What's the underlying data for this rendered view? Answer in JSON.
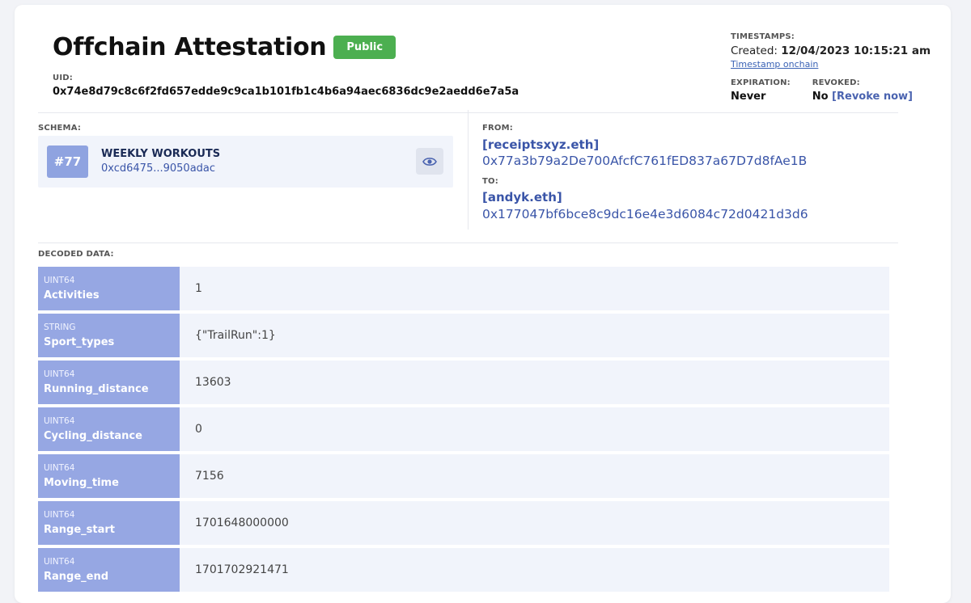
{
  "header": {
    "title": "Offchain Attestation",
    "badge": "Public",
    "uid_label": "UID:",
    "uid": "0x74e8d79c8c6f2fd657edde9c9ca1b101fb1c4b6a94aec6836dc9e2aedd6e7a5a"
  },
  "timestamps": {
    "label": "TIMESTAMPS:",
    "created_prefix": "Created:",
    "created_value": "12/04/2023 10:15:21 am",
    "onchain_link": "Timestamp onchain",
    "expiration_label": "EXPIRATION:",
    "expiration_value": "Never",
    "revoked_label": "REVOKED:",
    "revoked_value": "No",
    "revoke_link": "[Revoke now]"
  },
  "schema": {
    "label": "SCHEMA:",
    "number": "#77",
    "name": "WEEKLY WORKOUTS",
    "address": "0xcd6475...9050adac",
    "view_icon": "eye-icon"
  },
  "from": {
    "label": "FROM:",
    "ens": "[receiptsxyz.eth]",
    "address": "0x77a3b79a2De700AfcfC761fED837a67D7d8fAe1B"
  },
  "to": {
    "label": "TO:",
    "ens": "[andyk.eth]",
    "address": "0x177047bf6bce8c9dc16e4e3d6084c72d0421d3d6"
  },
  "decoded": {
    "label": "DECODED DATA:",
    "rows": [
      {
        "type": "UINT64",
        "name": "Activities",
        "value": "1"
      },
      {
        "type": "STRING",
        "name": "Sport_types",
        "value": "{\"TrailRun\":1}"
      },
      {
        "type": "UINT64",
        "name": "Running_distance",
        "value": "13603"
      },
      {
        "type": "UINT64",
        "name": "Cycling_distance",
        "value": "0"
      },
      {
        "type": "UINT64",
        "name": "Moving_time",
        "value": "7156"
      },
      {
        "type": "UINT64",
        "name": "Range_start",
        "value": "1701648000000"
      },
      {
        "type": "UINT64",
        "name": "Range_end",
        "value": "1701702921471"
      }
    ]
  },
  "colors": {
    "badge_green": "#4caf50",
    "schema_chip": "#8fa3e0",
    "key_cell": "#96a7e3",
    "link_blue": "#3a55a8",
    "value_bg": "#f1f4fb"
  }
}
